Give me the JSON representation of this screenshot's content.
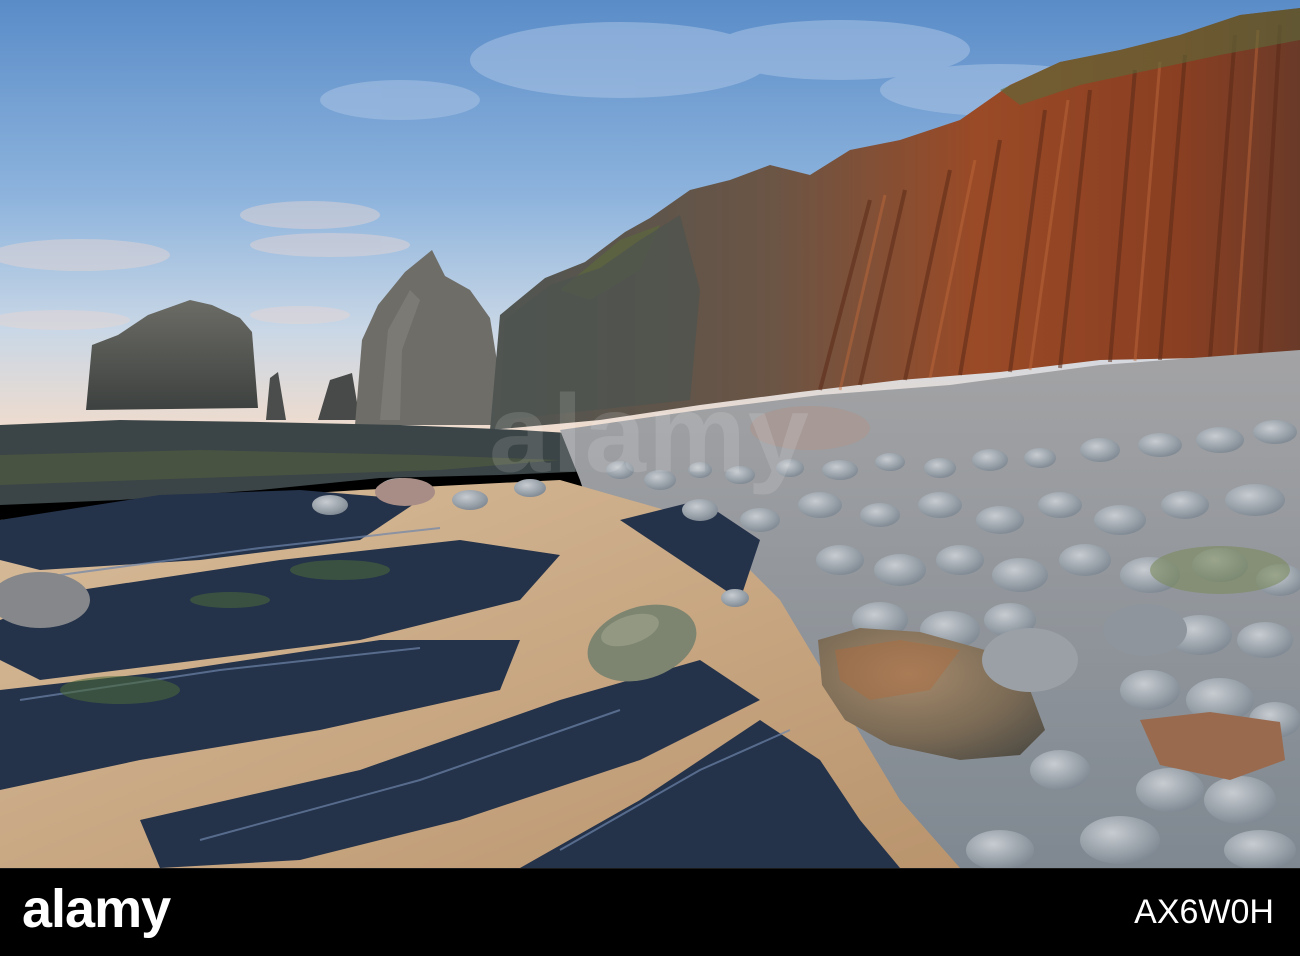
{
  "photo": {
    "subject": "coastal-cliffs-pebble-beach",
    "colors": {
      "sky_top": "#5c8ec9",
      "sky_horizon": "#f1d9c6",
      "cliff_orange": "#9a4a26",
      "cliff_grey": "#5a5c5a",
      "rock_blue": "#2b3a55",
      "sand": "#cfb08e",
      "pebble": "#9aa3ad"
    }
  },
  "watermark": {
    "text": "alamy"
  },
  "footer": {
    "logo": "alamy",
    "image_id": "AX6W0H",
    "background": "#000000",
    "text_color": "#ffffff"
  }
}
